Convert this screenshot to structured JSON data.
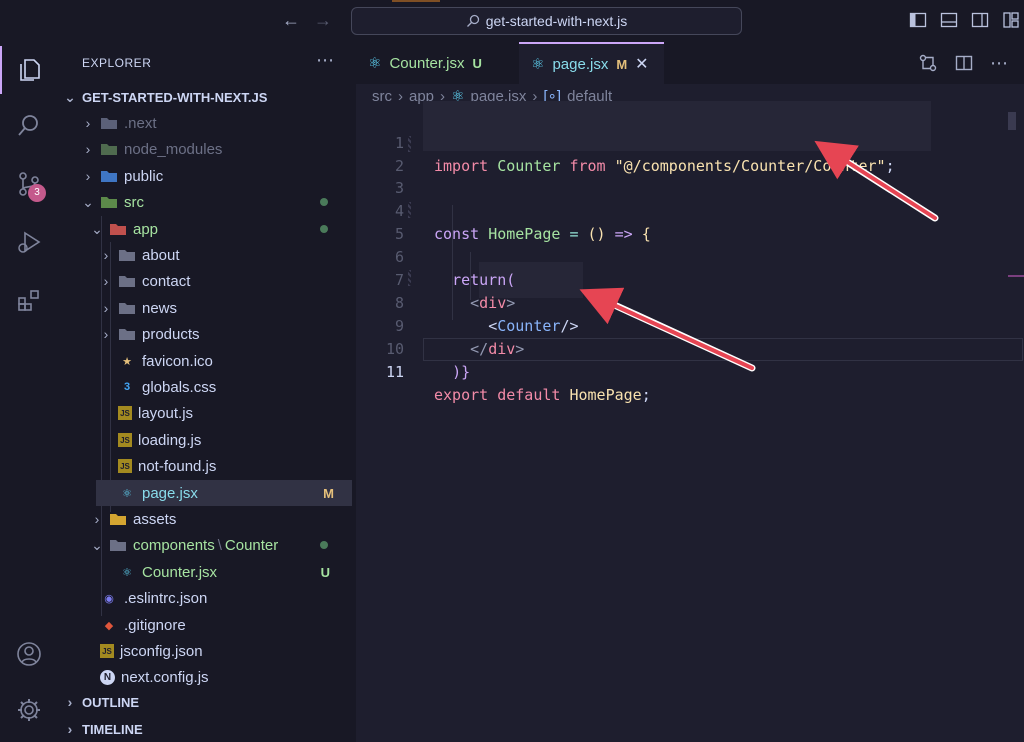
{
  "titlebar": {
    "search_text": "get-started-with-next.js",
    "back_icon": "arrow-left-icon",
    "forward_icon": "arrow-right-icon"
  },
  "activity": {
    "items": [
      "files-icon",
      "search-icon",
      "source-control-icon",
      "run-debug-icon",
      "extensions-icon"
    ],
    "scm_badge": "3",
    "bottom": [
      "account-icon",
      "settings-gear-icon"
    ]
  },
  "explorer": {
    "header": "EXPLORER",
    "project": "GET-STARTED-WITH-NEXT.JS",
    "rows": [
      {
        "label": ".next",
        "status": ""
      },
      {
        "label": "node_modules",
        "status": ""
      },
      {
        "label": "public",
        "status": ""
      },
      {
        "label": "src",
        "status": ""
      },
      {
        "label": "app",
        "status": ""
      },
      {
        "label": "about",
        "status": ""
      },
      {
        "label": "contact",
        "status": ""
      },
      {
        "label": "news",
        "status": ""
      },
      {
        "label": "products",
        "status": ""
      },
      {
        "label": "favicon.ico",
        "status": ""
      },
      {
        "label": "globals.css",
        "status": ""
      },
      {
        "label": "layout.js",
        "status": ""
      },
      {
        "label": "loading.js",
        "status": ""
      },
      {
        "label": "not-found.js",
        "status": ""
      },
      {
        "label": "page.jsx",
        "status": "M"
      },
      {
        "label": "assets",
        "status": ""
      },
      {
        "label": "components",
        "sep": "\\",
        "sub": "Counter",
        "status": ""
      },
      {
        "label": "Counter.jsx",
        "status": "U"
      },
      {
        "label": ".eslintrc.json",
        "status": ""
      },
      {
        "label": ".gitignore",
        "status": ""
      },
      {
        "label": "jsconfig.json",
        "status": ""
      },
      {
        "label": "next.config.js",
        "status": ""
      }
    ],
    "outline": "OUTLINE",
    "timeline": "TIMELINE"
  },
  "tabs": [
    {
      "label": "Counter.jsx",
      "status": "U"
    },
    {
      "label": "page.jsx",
      "status": "M"
    }
  ],
  "breadcrumb": [
    "src",
    "app",
    "page.jsx",
    "default"
  ],
  "code": {
    "line_numbers": [
      "1",
      "2",
      "3",
      "4",
      "5",
      "6",
      "7",
      "8",
      "9",
      "10",
      "11"
    ],
    "l1_import": "import",
    "l1_name": "Counter",
    "l1_from": "from",
    "l1_path": "\"@/components/Counter/Counter\"",
    "l1_semi": ";",
    "l4_const": "const",
    "l4_name": "HomePage",
    "l4_eq": "=",
    "l4_parens": "()",
    "l4_arrow": "=>",
    "l4_brace": "{",
    "l6_return": "return",
    "l6_paren": "(",
    "l7_open": "<",
    "l7_tag": "div",
    "l7_close": ">",
    "l8_open": "<",
    "l8_comp": "Counter",
    "l8_close": "/>",
    "l9_open": "</",
    "l9_tag": "div",
    "l9_close": ">",
    "l10": ")}",
    "l11_export": "export",
    "l11_default": "default",
    "l11_name": "HomePage",
    "l11_semi": ";"
  },
  "colors": {
    "background": "#1e1e2e",
    "sidebar": "#181825",
    "accent": "#cba6f7",
    "modified": "#e5c07b",
    "untracked": "#a6e3a1",
    "arrow": "#e64553"
  }
}
